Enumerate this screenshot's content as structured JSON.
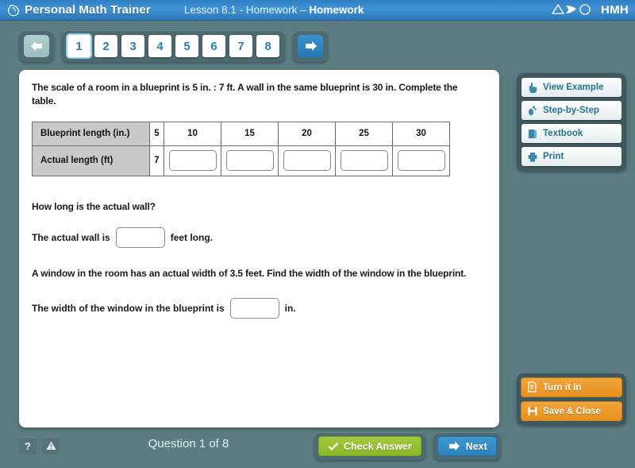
{
  "header": {
    "app_title": "Personal Math Trainer",
    "app_logo_icon": "leaf-drop-logo-icon",
    "lesson_label": "Lesson 8.1 - Homework – ",
    "lesson_name": "Homework",
    "brand_text": "HMH",
    "brand_icons": [
      "triangle-icon",
      "leaf-icon",
      "circle-icon"
    ]
  },
  "pager": {
    "prev_icon": "arrow-left-icon",
    "next_icon": "arrow-right-icon",
    "prev_enabled": false,
    "next_enabled": true,
    "pages": [
      "1",
      "2",
      "3",
      "4",
      "5",
      "6",
      "7",
      "8"
    ],
    "current_page": "1"
  },
  "content": {
    "prompt_1": "The scale of a room in a blueprint is 5 in. : 7 ft. A wall in the same blueprint is 30 in. Complete the table.",
    "table": {
      "row_headers": [
        "Blueprint length (in.)",
        "Actual length (ft)"
      ],
      "blueprint_lengths": [
        "5",
        "10",
        "15",
        "20",
        "25",
        "30"
      ],
      "actual_lengths": [
        "7",
        "",
        "",
        "",
        "",
        ""
      ],
      "input_values": [
        "",
        "",
        "",
        "",
        ""
      ],
      "input_placeholder": ""
    },
    "question_howlong": "How long is the actual wall?",
    "fill_1_before": "The actual wall is",
    "fill_1_value": "",
    "fill_1_after": "feet long.",
    "prompt_2": "A window in the room has an actual width of 3.5 feet. Find the width of the window in the blueprint.",
    "fill_2_before": "The width of the window in the blueprint is",
    "fill_2_value": "",
    "fill_2_after": "in."
  },
  "tools": [
    {
      "label": "View Example",
      "icon": "pointing-hand-icon"
    },
    {
      "label": "Step-by-Step",
      "icon": "footprints-icon"
    },
    {
      "label": "Textbook",
      "icon": "book-icon"
    },
    {
      "label": "Print",
      "icon": "printer-icon"
    }
  ],
  "submit_actions": [
    {
      "label": "Turn it In",
      "icon": "document-submit-icon"
    },
    {
      "label": "Save & Close",
      "icon": "floppy-disk-icon"
    }
  ],
  "footer": {
    "help_label": "?",
    "help_icon": "question-mark-icon",
    "alert_icon": "warning-triangle-icon",
    "question_counter": "Question 1 of 8",
    "check_answer_label": "Check Answer",
    "check_answer_icon": "checkmark-icon",
    "next_label": "Next",
    "next_icon": "arrow-right-icon"
  },
  "colors": {
    "page_background": "#5b7d82",
    "header_blue": "#3f93d4",
    "panel_white": "#ffffff",
    "accent_orange": "#e8921f",
    "accent_green": "#8ab828",
    "accent_blue": "#2b82bd",
    "tool_text": "#26748f"
  }
}
